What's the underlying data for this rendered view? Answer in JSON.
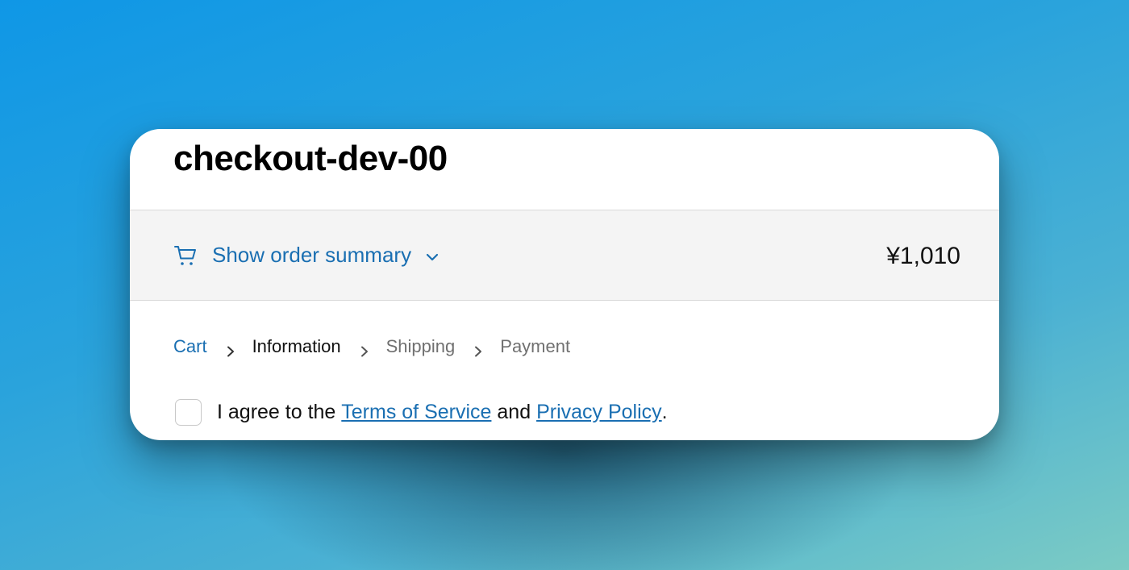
{
  "store": {
    "title": "checkout-dev-00"
  },
  "order_summary": {
    "toggle_label": "Show order summary",
    "total": "¥1,010",
    "icons": {
      "cart": "cart-icon",
      "toggle": "chevron-down-icon"
    }
  },
  "breadcrumb": {
    "items": [
      {
        "label": "Cart",
        "state": "link"
      },
      {
        "label": "Information",
        "state": "current"
      },
      {
        "label": "Shipping",
        "state": "upcoming"
      },
      {
        "label": "Payment",
        "state": "upcoming"
      }
    ],
    "separator_icon": "chevron-right-icon"
  },
  "agreement": {
    "prefix": "I agree to the ",
    "terms_link": "Terms of Service",
    "middle": " and ",
    "privacy_link": "Privacy Policy",
    "suffix": "."
  },
  "colors": {
    "link": "#1a6fb2",
    "summary_bg": "#f4f4f4",
    "background_gradient_start": "#0f97e6",
    "background_gradient_end": "#7ccbc4"
  }
}
